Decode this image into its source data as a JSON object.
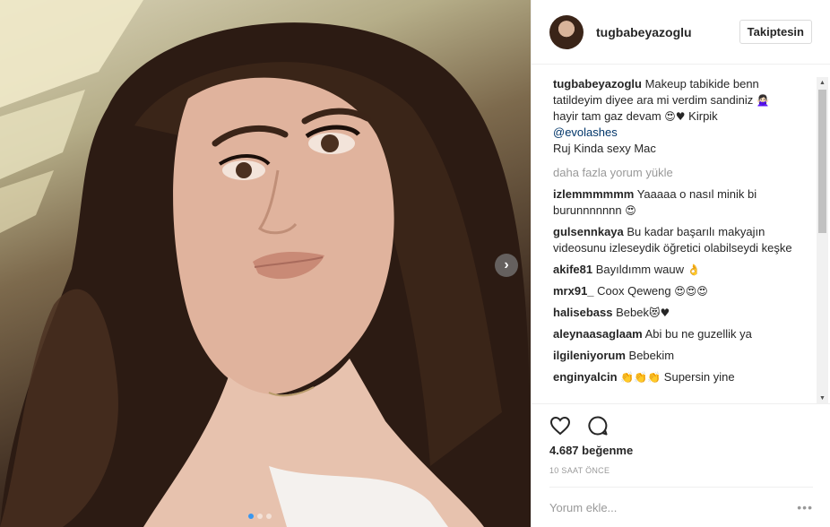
{
  "header": {
    "username": "tugbabeyazoglu",
    "follow_label": "Takiptesin"
  },
  "caption": {
    "username": "tugbabeyazoglu",
    "text_1": "Makeup tabikide benn tatildeyim diyee ara mi verdim sandiniz ",
    "emoji_1": "🙅🏻‍♀️",
    "text_2": " hayir tam gaz devam ",
    "emoji_2": "😍♥",
    "text_3": " Kirpik ",
    "mention": "@evolashes",
    "text_4": "Ruj Kinda sexy Mac"
  },
  "load_more_label": "daha fazla yorum yükle",
  "comments": [
    {
      "user": "izlemmmmmm",
      "text": "Yaaaaa o nasıl minik bi burunnnnnnn",
      "emoji": "😍"
    },
    {
      "user": "gulsennkaya",
      "text": "Bu kadar başarılı makyajın videosunu izleseydik öğretici olabilseydi keşke",
      "emoji": ""
    },
    {
      "user": "akife81",
      "text": "Bayıldımm wauw",
      "emoji": "👌"
    },
    {
      "user": "mrx91_",
      "text": "Coox Qeweng",
      "emoji": "😍😍😍"
    },
    {
      "user": "halisebass",
      "text": "Bebek",
      "emoji": "😻♥"
    },
    {
      "user": "aleynaasaglaam",
      "text": "Abi bu ne guzellik ya",
      "emoji": ""
    },
    {
      "user": "ilgileniyorum",
      "text": "Bebekim",
      "emoji": ""
    },
    {
      "user": "enginyalcin",
      "text": "Supersin yine",
      "emoji": "👏👏👏 "
    }
  ],
  "likes_text": "4.687 beğenme",
  "time_text": "10 SAAT ÖNCE",
  "comment_placeholder": "Yorum ekle...",
  "more_label": "•••",
  "colors": {
    "accent": "#3897f0",
    "text": "#262626",
    "muted": "#999999",
    "link": "#003569"
  },
  "icons": {
    "like": "heart-icon",
    "comment": "comment-bubble-icon",
    "next": "chevron-right-icon"
  }
}
